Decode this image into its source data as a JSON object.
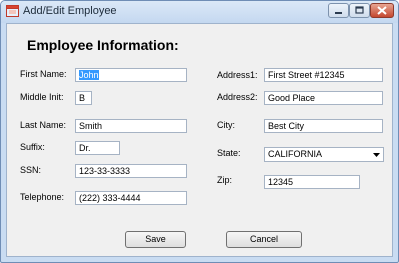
{
  "window": {
    "title": "Add/Edit Employee"
  },
  "form": {
    "heading": "Employee Information:",
    "first_name": {
      "label": "First Name:",
      "value": "John"
    },
    "middle_init": {
      "label": "Middle Init:",
      "value": "B"
    },
    "last_name": {
      "label": "Last Name:",
      "value": "Smith"
    },
    "suffix": {
      "label": "Suffix:",
      "value": "Dr."
    },
    "ssn": {
      "label": "SSN:",
      "value": "123-33-3333"
    },
    "telephone": {
      "label": "Telephone:",
      "value": "(222) 333-4444"
    },
    "address1": {
      "label": "Address1:",
      "value": "First Street #12345"
    },
    "address2": {
      "label": "Address2:",
      "value": "Good Place"
    },
    "city": {
      "label": "City:",
      "value": "Best City"
    },
    "state": {
      "label": "State:",
      "value": "CALIFORNIA"
    },
    "zip": {
      "label": "Zip:",
      "value": "12345"
    }
  },
  "buttons": {
    "save": "Save",
    "cancel": "Cancel"
  }
}
